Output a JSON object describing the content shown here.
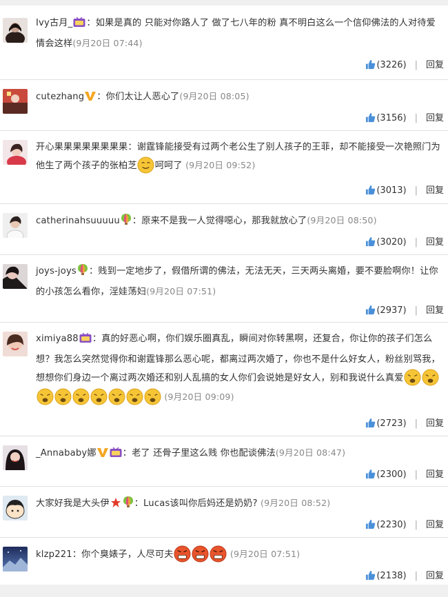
{
  "comments": [
    {
      "username": "Ivy古月_",
      "text": "：如果是真的 只能对你路人了 做了七八年的粉 真不明白这么一个信仰佛法的人对待爱情会这样",
      "time": "(9月20日 07:44)",
      "likes": "(3226)",
      "reply": "回复",
      "badges": [
        "video-badge-icon"
      ]
    },
    {
      "username": "cutezhang",
      "text": "：你们太让人恶心了",
      "time": "(9月20日 08:05)",
      "likes": "(3156)",
      "reply": "回复",
      "badges": [
        "verified-v-icon"
      ]
    },
    {
      "username": "开心果果果果果果果果",
      "text": "：谢霆锋能接受有过两个老公生了别人孩子的王菲，却不能接受一次艳照门为他生了两个孩子的张柏芝",
      "text_after_emoji": "呵呵了",
      "time": "(9月20日 09:52)",
      "likes": "(3013)",
      "reply": "回复",
      "badges": []
    },
    {
      "username": "catherinahsuuuuu",
      "text": "：原来不是我一人觉得噁心，那我就放心了",
      "time": "(9月20日 08:50)",
      "likes": "(3020)",
      "reply": "回复",
      "badges": [
        "balloon-badge-icon"
      ]
    },
    {
      "username": "joys-joys",
      "text": "：贱到一定地步了，假借所谓的佛法，无法无天，三天两头离婚，要不要脸啊你！让你的小孩怎么看你，淫娃荡妇",
      "time": "(9月20日 07:51)",
      "likes": "(2937)",
      "reply": "回复",
      "badges": [
        "balloon-badge-icon"
      ]
    },
    {
      "username": "ximiya88",
      "text": "：真的好恶心啊，你们娱乐圈真乱，瞬间对你转黑啊，还复合，你让你的孩子们怎么想？我怎么突然觉得你和谢霆锋那么恶心呢，都离过两次婚了，你也不是什么好女人，粉丝别骂我，想想你们身边一个离过两次婚还和别人乱搞的女人你们会说她是好女人，别和我说什么真爱",
      "time": "(9月20日 09:09)",
      "likes": "(2723)",
      "reply": "回复",
      "badges": [
        "video-badge-icon"
      ]
    },
    {
      "username": "_Annababy娜",
      "text": "：老了 还骨子里这么贱 你也配谈佛法",
      "time": "(9月20日 08:47)",
      "likes": "(2300)",
      "reply": "回复",
      "badges": [
        "verified-v-icon",
        "video-badge-icon"
      ]
    },
    {
      "username": "大家好我是大头伊",
      "text": "：Lucas该叫你后妈还是奶奶?",
      "time": "(9月20日 08:52)",
      "likes": "(2230)",
      "reply": "回复",
      "badges": [
        "star-badge-icon",
        "balloon-badge-icon"
      ]
    },
    {
      "username": "klzp221",
      "text": "：你个臭婊子，人尽可夫",
      "time": "(9月20日 07:51)",
      "likes": "(2138)",
      "reply": "回复",
      "badges": []
    }
  ],
  "colors": {
    "thumb": "#4a90d9",
    "verified_v": "#f5a623",
    "video_badge": "#8a4fc3",
    "emoji_yellow": "#f6c536",
    "emoji_angry": "#e8542c"
  }
}
